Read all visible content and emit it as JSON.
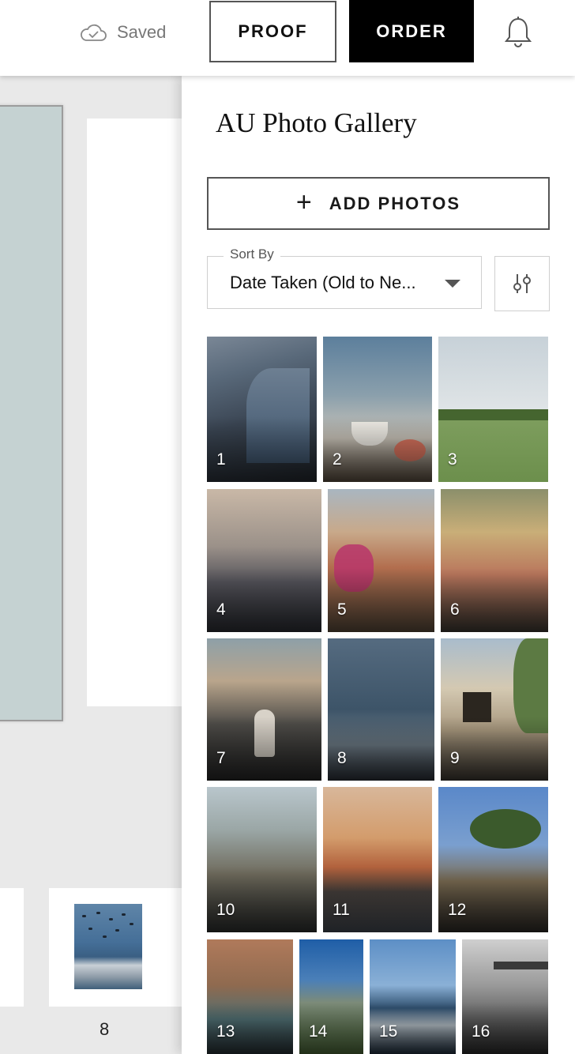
{
  "header": {
    "saved_label": "Saved",
    "proof_label": "PROOF",
    "order_label": "ORDER"
  },
  "canvas": {
    "thumbnail_page_number": "8"
  },
  "panel": {
    "title": "AU Photo Gallery",
    "add_photos_label": "ADD PHOTOS",
    "sort": {
      "label": "Sort By",
      "value": "Date Taken (Old to Ne..."
    },
    "photos": [
      "1",
      "2",
      "3",
      "4",
      "5",
      "6",
      "7",
      "8",
      "9",
      "10",
      "11",
      "12",
      "13",
      "14",
      "15",
      "16"
    ]
  },
  "colors": {
    "accent_black": "#000000",
    "canvas_bg": "#e9e9e9",
    "page_left_fill": "#c5d2d2"
  }
}
